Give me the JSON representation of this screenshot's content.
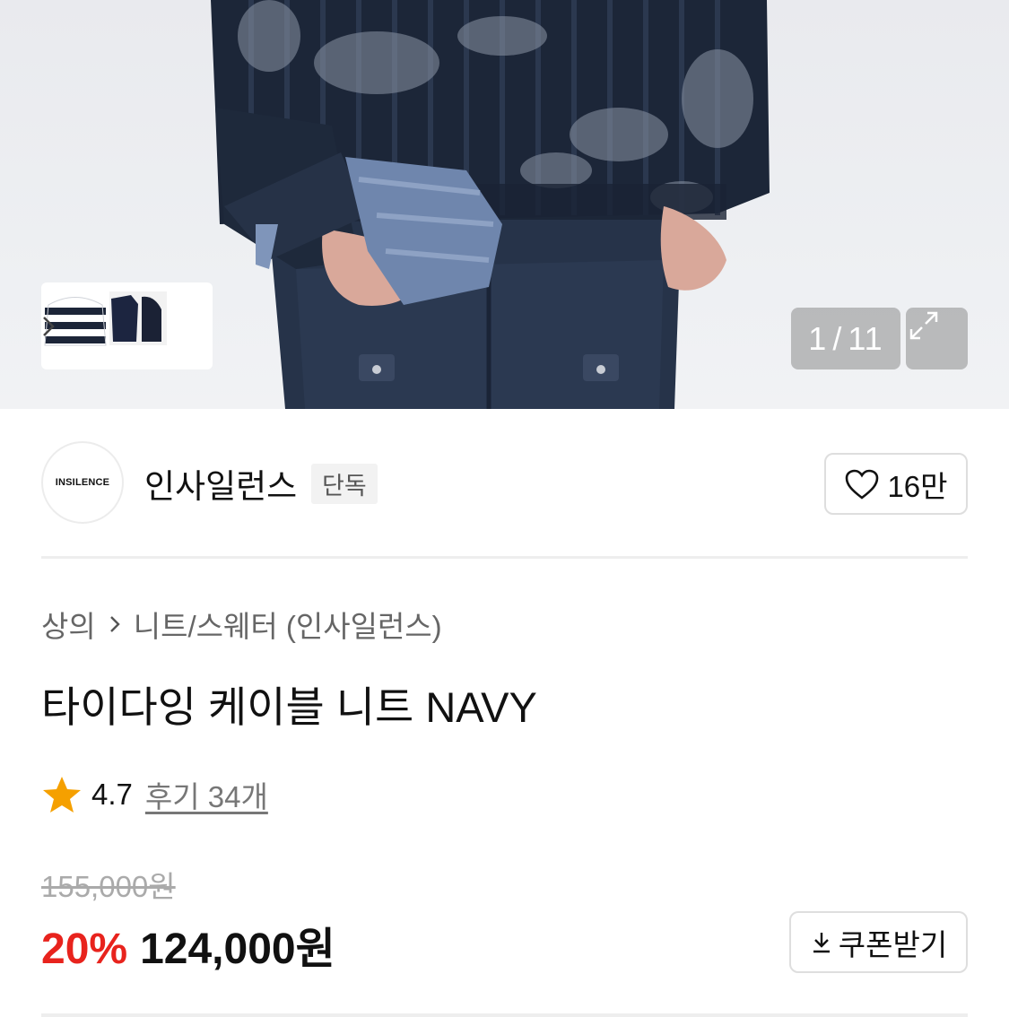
{
  "gallery": {
    "current_index": "1",
    "separator": "/",
    "total": "11",
    "icons": [
      "chevron-right-icon",
      "expand-icon"
    ]
  },
  "brand": {
    "logo_text": "INSILENCE",
    "name": "인사일런스",
    "badge": "단독",
    "likes": "16만"
  },
  "breadcrumb": {
    "category": "상의",
    "subcategory": "니트/스웨터 (인사일런스)"
  },
  "product": {
    "title": "타이다잉 케이블 니트 NAVY",
    "rating": "4.7",
    "reviews_label": "후기 34개",
    "original_price": "155,000원",
    "discount": "20%",
    "sale_price": "124,000원"
  },
  "actions": {
    "coupon_label": "쿠폰받기"
  },
  "colors": {
    "discount_red": "#e8231d",
    "star_orange": "#f5a000"
  }
}
